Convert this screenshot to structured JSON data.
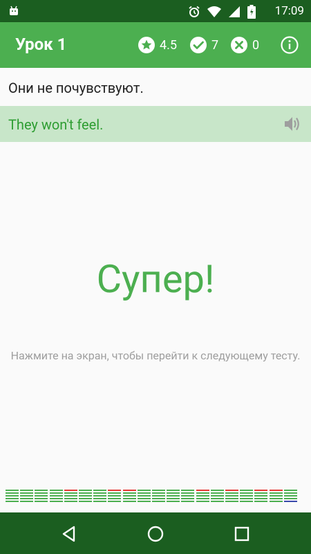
{
  "status_bar": {
    "time": "17:09"
  },
  "app_bar": {
    "title": "Урок 1",
    "rating": "4.5",
    "correct_count": "7",
    "wrong_count": "0"
  },
  "question": {
    "text": "Они не почувствуют."
  },
  "answer": {
    "text": "They won't feel."
  },
  "result": {
    "message": "Супер!",
    "hint": "Нажмите на экран, чтобы перейти к следующему тесту."
  },
  "progress": {
    "colors": {
      "correct": "#4caf50",
      "wrong": "#e53935",
      "current": "#3949ab"
    },
    "columns": [
      [
        "correct",
        "correct",
        "correct",
        "correct",
        "correct"
      ],
      [
        "correct",
        "correct",
        "correct",
        "correct",
        "correct"
      ],
      [
        "correct",
        "correct",
        "correct",
        "correct",
        "correct"
      ],
      [
        "correct",
        "correct",
        "correct",
        "correct",
        "correct"
      ],
      [
        "wrong",
        "correct",
        "correct",
        "correct",
        "correct"
      ],
      [
        "correct",
        "correct",
        "correct",
        "correct",
        "correct"
      ],
      [
        "correct",
        "correct",
        "correct",
        "correct",
        "correct"
      ],
      [
        "wrong",
        "correct",
        "correct",
        "correct",
        "correct"
      ],
      [
        "wrong",
        "correct",
        "correct",
        "correct",
        "correct"
      ],
      [
        "correct",
        "correct",
        "correct",
        "correct",
        "correct"
      ],
      [
        "correct",
        "correct",
        "correct",
        "correct",
        "correct"
      ],
      [
        "correct",
        "correct",
        "correct",
        "correct",
        "correct"
      ],
      [
        "correct",
        "correct",
        "correct",
        "correct",
        "correct"
      ],
      [
        "wrong",
        "correct",
        "correct",
        "correct",
        "correct"
      ],
      [
        "correct",
        "correct",
        "correct",
        "correct",
        "correct"
      ],
      [
        "wrong",
        "correct",
        "correct",
        "correct",
        "correct"
      ],
      [
        "correct",
        "correct",
        "correct",
        "correct",
        "correct"
      ],
      [
        "wrong",
        "correct",
        "correct",
        "correct",
        "correct"
      ],
      [
        "wrong",
        "correct",
        "correct",
        "correct",
        "correct"
      ],
      [
        "correct",
        "correct",
        "correct",
        "correct",
        "current"
      ]
    ]
  },
  "icons": {
    "status": [
      "android-icon",
      "alarm-icon",
      "wifi-icon",
      "signal-icon",
      "battery-icon"
    ],
    "app_bar": [
      "star-icon",
      "check-circle-icon",
      "x-circle-icon",
      "info-icon"
    ],
    "nav": [
      "back-icon",
      "home-icon",
      "recents-icon"
    ]
  }
}
